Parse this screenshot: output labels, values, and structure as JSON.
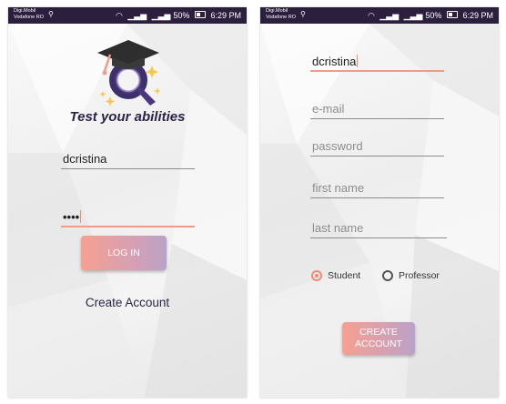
{
  "status_bar": {
    "carrier_line1": "Digi.Mobil",
    "carrier_line2": "Vodafone RO",
    "battery": "50%",
    "time": "6:29 PM"
  },
  "login": {
    "title": "Test your abilities",
    "username_value": "dcristina",
    "password_masked": "••••",
    "login_button": "LOG IN",
    "create_account_link": "Create Account"
  },
  "register": {
    "username_value": "dcristina",
    "email_placeholder": "e-mail",
    "password_placeholder": "password",
    "first_name_placeholder": "first name",
    "last_name_placeholder": "last name",
    "role_options": [
      "Student",
      "Professor"
    ],
    "selected_role": "Student",
    "create_button_line1": "CREATE",
    "create_button_line2": "ACCOUNT"
  },
  "colors": {
    "status_bar": "#2b1f3d",
    "accent": "#f08a78",
    "button_start": "#f7a08f",
    "button_end": "#b9a2c8",
    "title": "#2d2346"
  },
  "icons": [
    "graduation-cap-q-logo",
    "wifi-icon",
    "signal-icon",
    "battery-icon",
    "usb-icon"
  ]
}
